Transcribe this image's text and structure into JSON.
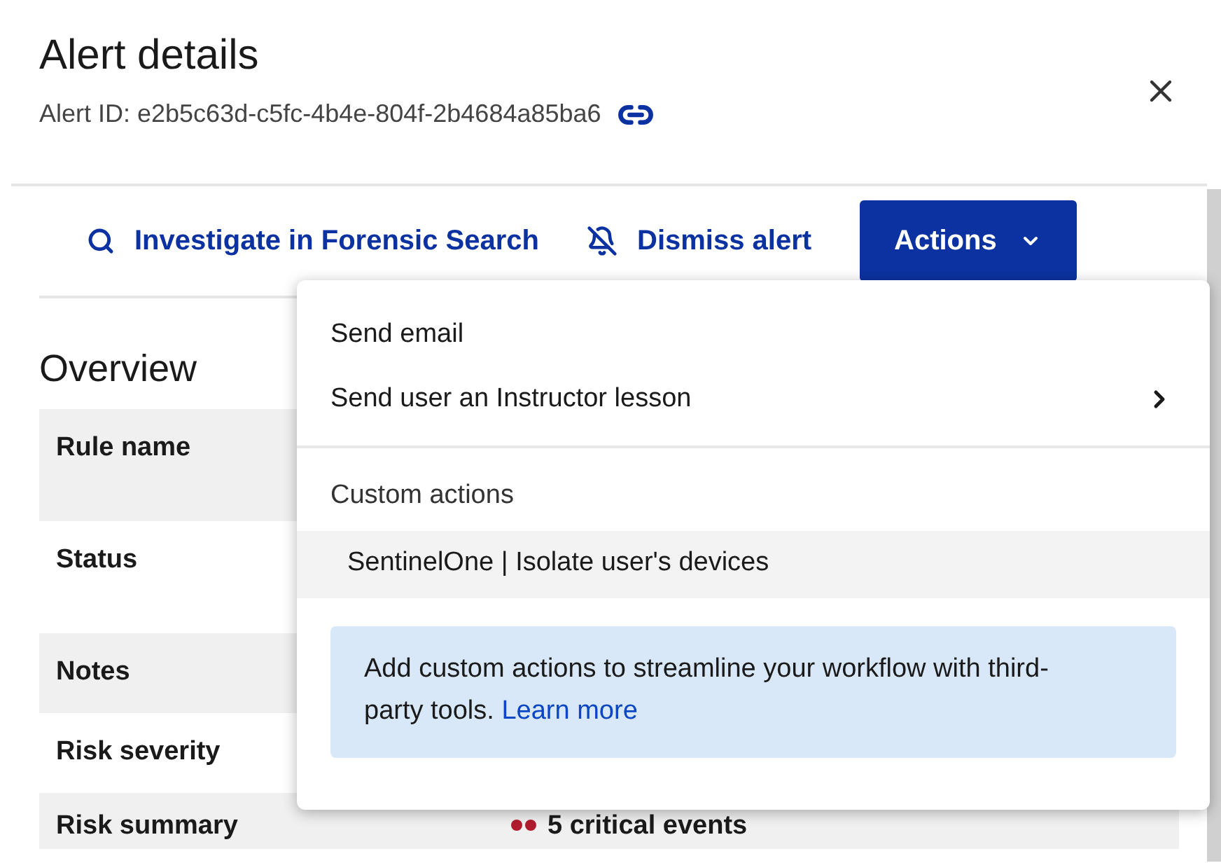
{
  "header": {
    "title": "Alert details",
    "alert_id": "Alert ID: e2b5c63d-c5fc-4b4e-804f-2b4684a85ba6"
  },
  "toolbar": {
    "investigate": "Investigate in Forensic Search",
    "dismiss": "Dismiss alert",
    "actions": "Actions"
  },
  "overview": {
    "title": "Overview",
    "rows": [
      {
        "label": "Rule name"
      },
      {
        "label": "Status"
      },
      {
        "label": "Notes"
      },
      {
        "label": "Risk severity"
      },
      {
        "label": "Risk summary",
        "value": "5 critical events"
      }
    ]
  },
  "actions_menu": {
    "items": [
      {
        "label": "Send email",
        "submenu": false
      },
      {
        "label": "Send user an Instructor lesson",
        "submenu": true
      }
    ],
    "custom_title": "Custom actions",
    "custom_items": [
      {
        "label": "SentinelOne | Isolate user's devices",
        "selected": true
      }
    ],
    "info_text": "Add custom actions to streamline your workflow with third-party tools.",
    "info_link": "Learn more"
  }
}
